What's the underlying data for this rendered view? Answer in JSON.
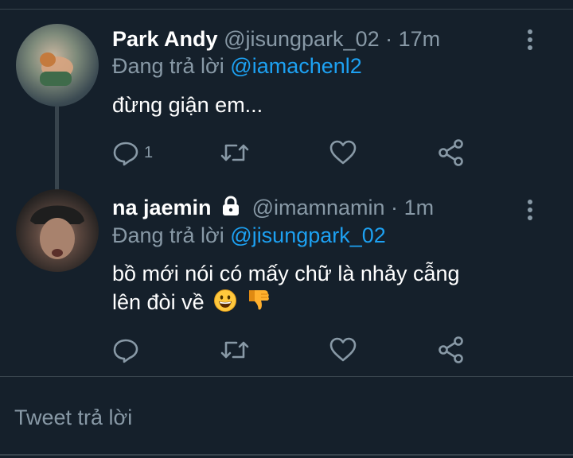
{
  "tweets": [
    {
      "name": "Park Andy",
      "handle": "@jisungpark_02",
      "separator": "·",
      "time": "17m",
      "replying_prefix": "Đang trả lời",
      "replying_to": "@iamachenl2",
      "text": "đừng giận em...",
      "reply_count": "1",
      "locked": false
    },
    {
      "name": "na jaemin",
      "handle": "@imamnamin",
      "separator": "·",
      "time": "1m",
      "replying_prefix": "Đang trả lời",
      "replying_to": "@jisungpark_02",
      "text_line1": "bồ mới nói có mấy chữ là nhảy cẫng",
      "text_line2": "lên đòi về",
      "locked": true
    }
  ],
  "composer": {
    "placeholder": "Tweet trả lời"
  },
  "colors": {
    "background": "#15202b",
    "divider": "#38444d",
    "secondary_text": "#8899a6",
    "accent": "#1da1f2"
  }
}
